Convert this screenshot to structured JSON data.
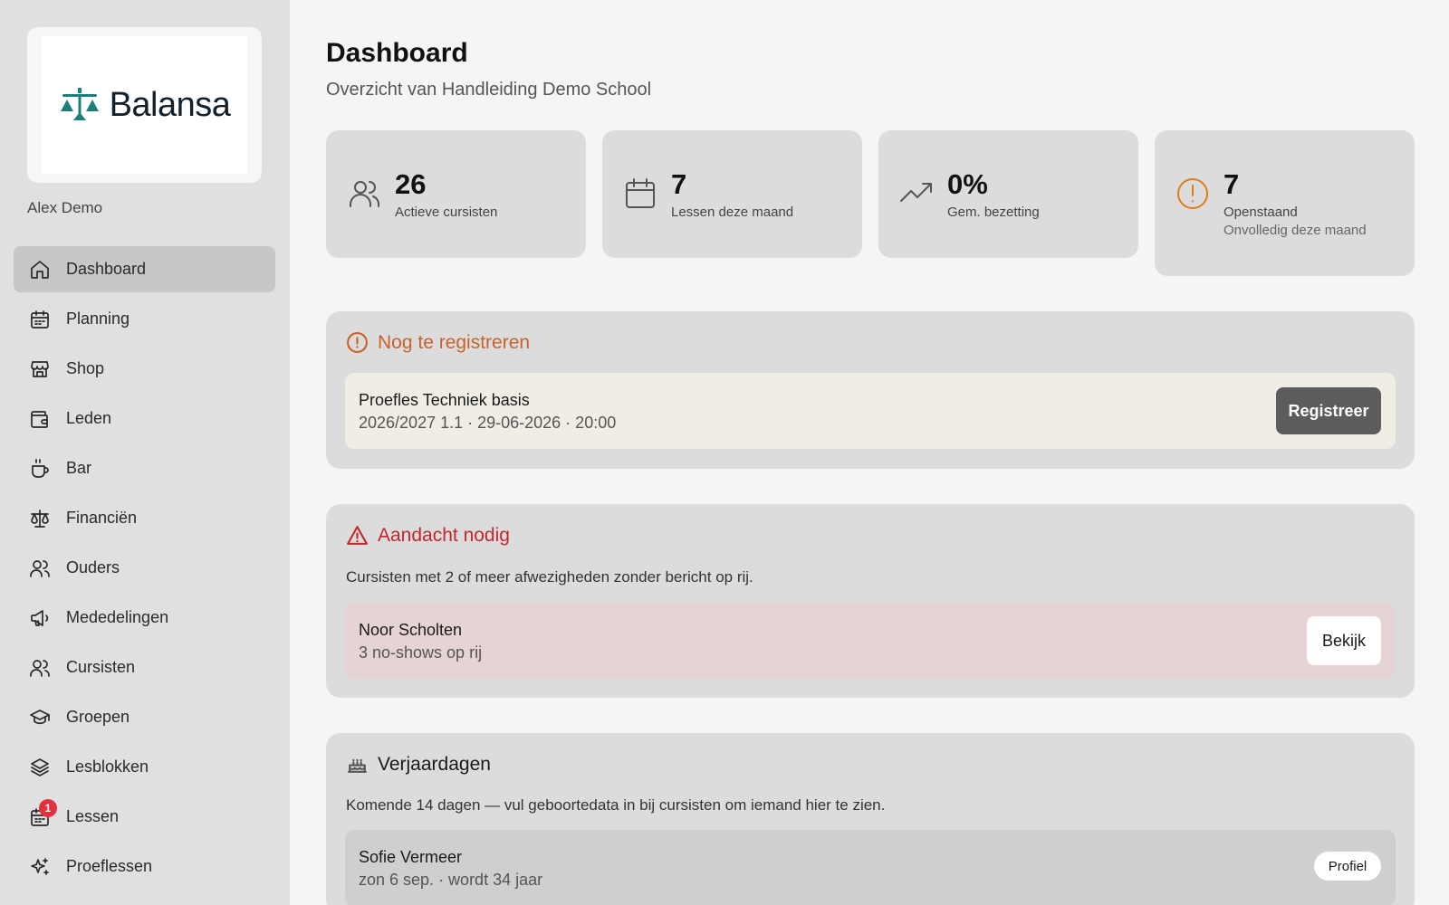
{
  "brand": {
    "name": "Balansa",
    "accent": "#1c7f7a"
  },
  "user": {
    "name": "Alex Demo"
  },
  "nav": [
    {
      "label": "Dashboard",
      "icon": "home-icon",
      "active": true
    },
    {
      "label": "Planning",
      "icon": "calendar-icon"
    },
    {
      "label": "Shop",
      "icon": "store-icon"
    },
    {
      "label": "Leden",
      "icon": "wallet-icon"
    },
    {
      "label": "Bar",
      "icon": "cup-icon"
    },
    {
      "label": "Financiën",
      "icon": "scale-icon"
    },
    {
      "label": "Ouders",
      "icon": "users-icon"
    },
    {
      "label": "Mededelingen",
      "icon": "megaphone-icon"
    },
    {
      "label": "Cursisten",
      "icon": "users-icon"
    },
    {
      "label": "Groepen",
      "icon": "graduation-cap-icon"
    },
    {
      "label": "Lesblokken",
      "icon": "layers-icon"
    },
    {
      "label": "Lessen",
      "icon": "calendar-grid-icon",
      "badge": "1"
    },
    {
      "label": "Proeflessen",
      "icon": "sparkles-icon"
    }
  ],
  "header": {
    "title": "Dashboard",
    "subtitle": "Overzicht van Handleiding Demo School"
  },
  "stats": [
    {
      "value": "26",
      "label": "Actieve cursisten",
      "icon": "users-icon"
    },
    {
      "value": "7",
      "label": "Lessen deze maand",
      "icon": "calendar-icon"
    },
    {
      "value": "0%",
      "label": "Gem. bezetting",
      "icon": "trending-up-icon"
    },
    {
      "value": "7",
      "label": "Openstaand",
      "sublabel": "Onvolledig deze maand",
      "icon": "alert-circle-icon",
      "color": "#e07b1a"
    }
  ],
  "register": {
    "title": "Nog te registreren",
    "color": "#c8622a",
    "item": {
      "title": "Proefles Techniek basis",
      "subtitle": "2026/2027 1.1 · 29-06-2026 · 20:00",
      "button": "Registreer"
    }
  },
  "attention": {
    "title": "Aandacht nodig",
    "color": "#c0282d",
    "description": "Cursisten met 2 of meer afwezigheden zonder bericht op rij.",
    "item": {
      "title": "Noor Scholten",
      "subtitle": "3 no-shows op rij",
      "button": "Bekijk"
    }
  },
  "birthdays": {
    "title": "Verjaardagen",
    "description": "Komende 14 dagen — vul geboortedata in bij cursisten om iemand hier te zien.",
    "item": {
      "title": "Sofie Vermeer",
      "subtitle": "zon 6 sep. · wordt 34 jaar",
      "button": "Profiel"
    }
  }
}
